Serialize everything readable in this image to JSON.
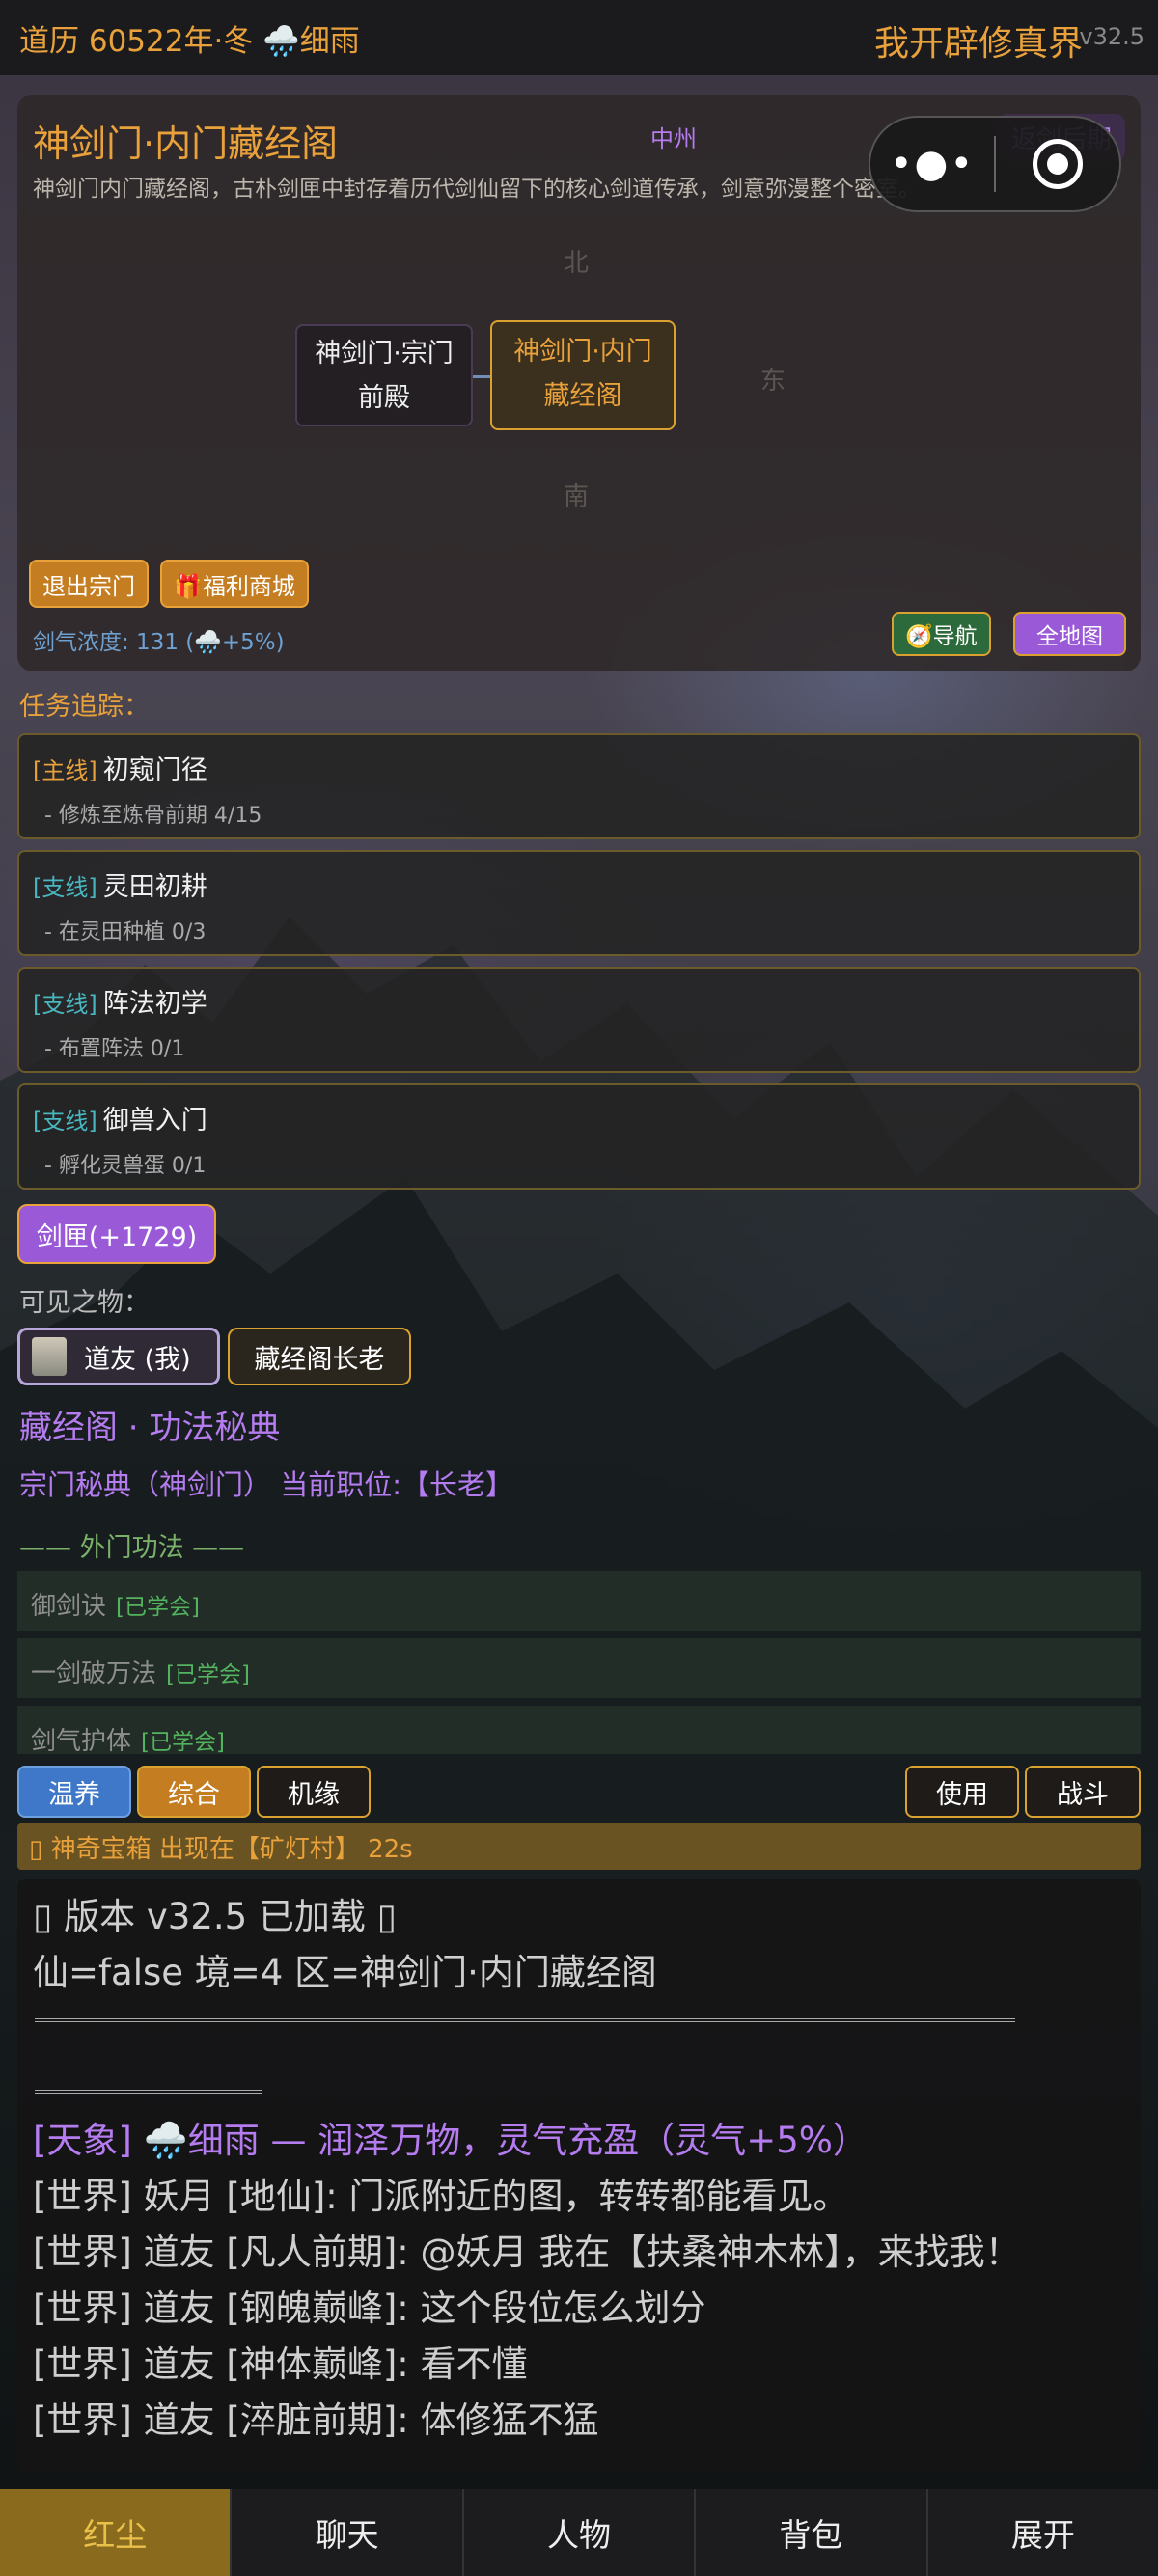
{
  "topbar": {
    "date": "道历 60522年·冬 🌧️细雨",
    "game": "我开辟修真界",
    "version": "v32.5"
  },
  "location": {
    "title": "神剑门·内门藏经阁",
    "region": "中州",
    "realm": "返剑后期",
    "description": "神剑门内门藏经阁，古朴剑匣中封存着历代剑仙留下的核心剑道传承，剑意弥漫整个密室。",
    "dir_north": "北",
    "dir_east": "东",
    "dir_south": "南",
    "node_a_line1": "神剑门·宗门",
    "node_a_line2": "前殿",
    "node_b_line1": "神剑门·内门",
    "node_b_line2": "藏经阁",
    "exit_label": "退出宗门",
    "shop_label": "🎁福利商城",
    "qi_text": "剑气浓度: 131 (🌧️+5%)",
    "nav_label": "🧭导航",
    "fullmap_label": "全地图"
  },
  "capsule": {
    "more": "•●•"
  },
  "quests": {
    "header": "任务追踪：",
    "items": [
      {
        "tag": "[主线]",
        "title": "初窥门径",
        "progress": "- 修炼至炼骨前期 4/15"
      },
      {
        "tag": "[支线]",
        "title": "灵田初耕",
        "progress": "- 在灵田种植 0/3"
      },
      {
        "tag": "[支线]",
        "title": "阵法初学",
        "progress": "- 布置阵法 0/1"
      },
      {
        "tag": "[支线]",
        "title": "御兽入门",
        "progress": "- 孵化灵兽蛋 0/1"
      }
    ]
  },
  "bag_button": "剑匣(+1729)",
  "visible": {
    "label": "可见之物：",
    "me": "道友 (我)",
    "elder": "藏经阁长老"
  },
  "library": {
    "title": "藏经阁 · 功法秘典",
    "sect": "宗门秘典（神剑门）  当前职位:【长老】",
    "outer": "—— 外门功法 ——",
    "skills": [
      {
        "name": "御剑诀",
        "status": "[已学会]"
      },
      {
        "name": "一剑破万法",
        "status": "[已学会]"
      },
      {
        "name": "剑气护体",
        "status": "[已学会]"
      }
    ]
  },
  "actions": {
    "warm": "温养",
    "general": "综合",
    "chance": "机缘",
    "use": "使用",
    "fight": "战斗"
  },
  "notice": "▯ 神奇宝箱 出现在【矿灯村】 22s",
  "log": {
    "version": "▯ 版本 v32.5 已加载 ▯",
    "state": "仙=false 境=4 区=神剑门·内门藏经阁",
    "weather": "[天象] 🌧️细雨 — 润泽万物，灵气充盈（灵气+5%）",
    "chat": [
      "[世界] 妖月 [地仙]: 门派附近的图，转转都能看见。",
      "[世界] 道友 [凡人前期]: @妖月 我在【扶桑神木林】，来找我！",
      "[世界] 道友 [钢魄巅峰]: 这个段位怎么划分",
      "[世界] 道友 [神体巅峰]: 看不懂",
      "[世界] 道友 [淬脏前期]: 体修猛不猛"
    ]
  },
  "bottom_tabs": [
    "红尘",
    "聊天",
    "人物",
    "背包",
    "展开"
  ]
}
